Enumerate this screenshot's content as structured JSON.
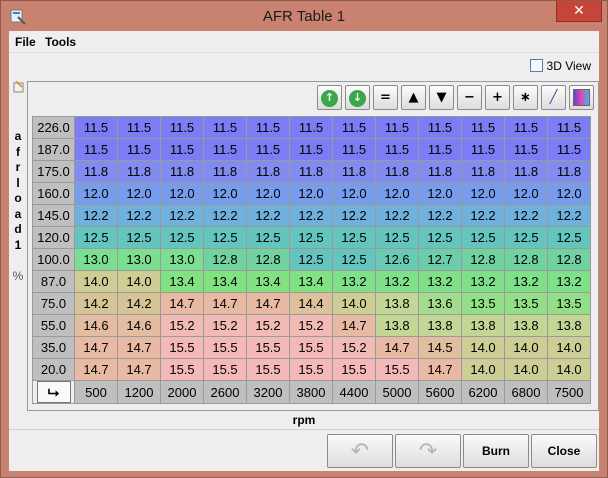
{
  "window": {
    "title": "AFR Table 1",
    "close_symbol": "✕"
  },
  "menu": [
    {
      "label": "File"
    },
    {
      "label": "Tools"
    }
  ],
  "view3d": {
    "label": "3D View",
    "checked": false
  },
  "toolbar": [
    {
      "name": "rotate-up-button",
      "icon": "green-up-arrow-icon",
      "label": ""
    },
    {
      "name": "rotate-down-button",
      "icon": "green-down-arrow-icon",
      "label": ""
    },
    {
      "name": "set-equal-button",
      "icon": "equals-icon",
      "label": "="
    },
    {
      "name": "increment-button",
      "icon": "triangle-up-icon",
      "label": "▲"
    },
    {
      "name": "decrement-button",
      "icon": "triangle-down-icon",
      "label": "▼"
    },
    {
      "name": "subtract-button",
      "icon": "minus-icon",
      "label": "−"
    },
    {
      "name": "add-button",
      "icon": "plus-icon",
      "label": "+"
    },
    {
      "name": "multiply-button",
      "icon": "asterisk-icon",
      "label": "∗"
    },
    {
      "name": "pencil-button",
      "icon": "pencil-icon",
      "label": "╱"
    },
    {
      "name": "color-button",
      "icon": "gradient-icon",
      "label": ""
    }
  ],
  "yaxis": {
    "title": "afrload1",
    "unit": "%",
    "values": [
      "226.0",
      "187.0",
      "175.0",
      "160.0",
      "145.0",
      "120.0",
      "100.0",
      "87.0",
      "75.0",
      "55.0",
      "35.0",
      "20.0"
    ]
  },
  "xaxis": {
    "title": "rpm",
    "values": [
      "500",
      "1200",
      "2000",
      "2600",
      "3200",
      "3800",
      "4400",
      "5000",
      "5600",
      "6200",
      "6800",
      "7500"
    ]
  },
  "table": [
    [
      "11.5",
      "11.5",
      "11.5",
      "11.5",
      "11.5",
      "11.5",
      "11.5",
      "11.5",
      "11.5",
      "11.5",
      "11.5",
      "11.5"
    ],
    [
      "11.5",
      "11.5",
      "11.5",
      "11.5",
      "11.5",
      "11.5",
      "11.5",
      "11.5",
      "11.5",
      "11.5",
      "11.5",
      "11.5"
    ],
    [
      "11.8",
      "11.8",
      "11.8",
      "11.8",
      "11.8",
      "11.8",
      "11.8",
      "11.8",
      "11.8",
      "11.8",
      "11.8",
      "11.8"
    ],
    [
      "12.0",
      "12.0",
      "12.0",
      "12.0",
      "12.0",
      "12.0",
      "12.0",
      "12.0",
      "12.0",
      "12.0",
      "12.0",
      "12.0"
    ],
    [
      "12.2",
      "12.2",
      "12.2",
      "12.2",
      "12.2",
      "12.2",
      "12.2",
      "12.2",
      "12.2",
      "12.2",
      "12.2",
      "12.2"
    ],
    [
      "12.5",
      "12.5",
      "12.5",
      "12.5",
      "12.5",
      "12.5",
      "12.5",
      "12.5",
      "12.5",
      "12.5",
      "12.5",
      "12.5"
    ],
    [
      "13.0",
      "13.0",
      "13.0",
      "12.8",
      "12.8",
      "12.5",
      "12.5",
      "12.6",
      "12.7",
      "12.8",
      "12.8",
      "12.8"
    ],
    [
      "14.0",
      "14.0",
      "13.4",
      "13.4",
      "13.4",
      "13.4",
      "13.2",
      "13.2",
      "13.2",
      "13.2",
      "13.2",
      "13.2"
    ],
    [
      "14.2",
      "14.2",
      "14.7",
      "14.7",
      "14.7",
      "14.4",
      "14.0",
      "13.8",
      "13.6",
      "13.5",
      "13.5",
      "13.5"
    ],
    [
      "14.6",
      "14.6",
      "15.2",
      "15.2",
      "15.2",
      "15.2",
      "14.7",
      "13.8",
      "13.8",
      "13.8",
      "13.8",
      "13.8"
    ],
    [
      "14.7",
      "14.7",
      "15.5",
      "15.5",
      "15.5",
      "15.5",
      "15.2",
      "14.7",
      "14.5",
      "14.0",
      "14.0",
      "14.0"
    ],
    [
      "14.7",
      "14.7",
      "15.5",
      "15.5",
      "15.5",
      "15.5",
      "15.5",
      "15.5",
      "14.7",
      "14.0",
      "14.0",
      "14.0"
    ]
  ],
  "buttons": {
    "undo": "↶",
    "redo": "↷",
    "burn": "Burn",
    "close": "Close"
  },
  "colors": {
    "rich": "#7c7cf4",
    "lean": "#f4b8b8",
    "window_frame": "#c9826f"
  }
}
